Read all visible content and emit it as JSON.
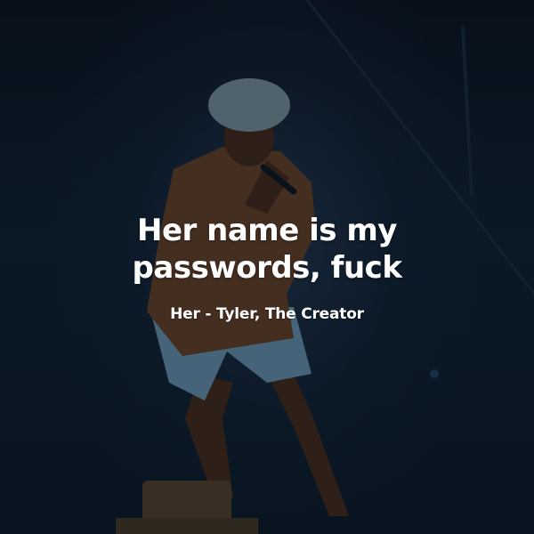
{
  "quote": {
    "text": "Her name is my passwords, fuck",
    "attribution": "Her - Tyler, The Creator"
  },
  "background": {
    "subject": "performer-on-stage",
    "colors": {
      "stage_dark": "#0b1622",
      "hat": "#9fb7bf",
      "shirt": "#8a5a35",
      "shorts": "#86b6d6",
      "skin": "#5a3826",
      "overlay": "#040a12"
    }
  }
}
